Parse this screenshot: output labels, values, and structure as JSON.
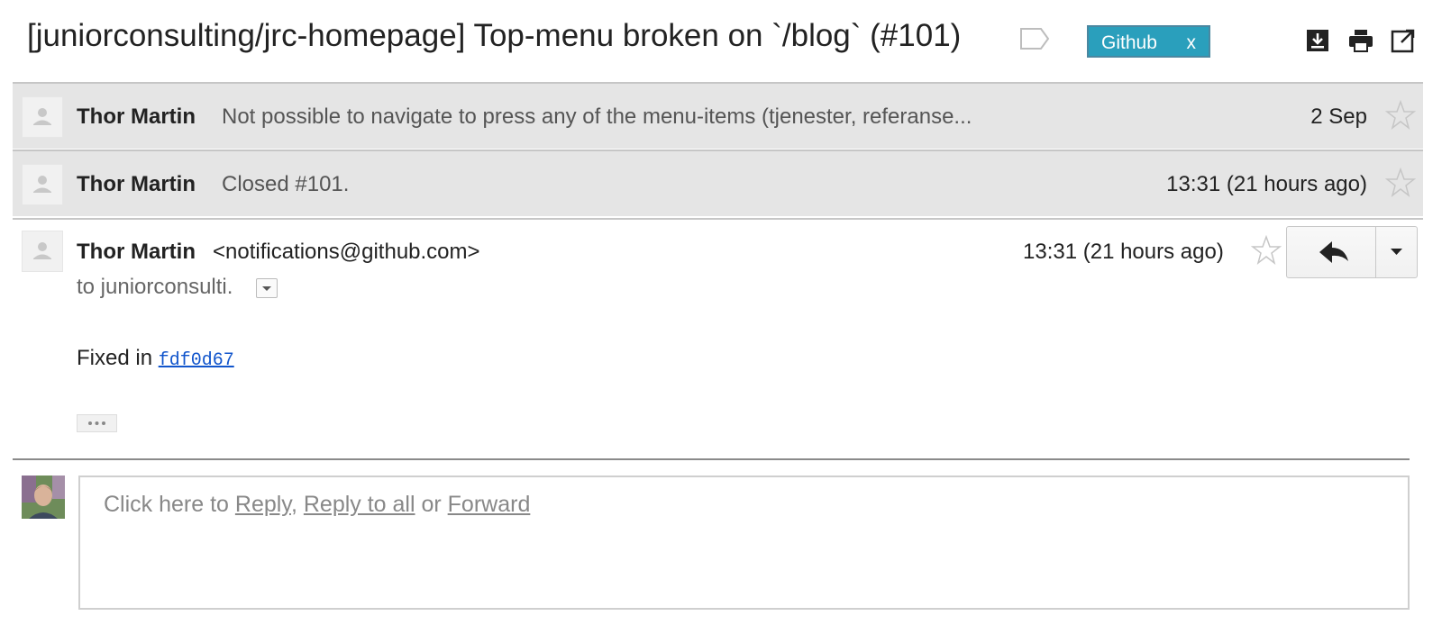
{
  "thread": {
    "subject": "[juniorconsulting/jrc-homepage] Top-menu broken on `/blog` (#101)",
    "label": {
      "name": "Github",
      "remove": "x",
      "color": "#2a9fbc"
    },
    "actions": [
      "download-icon",
      "print-icon",
      "open-in-new-window-icon"
    ]
  },
  "messages": [
    {
      "sender": "Thor Martin",
      "snippet": "Not possible to navigate to press any of the menu-items (tjenester, referanse...",
      "time": "2 Sep"
    },
    {
      "sender": "Thor Martin",
      "snippet": "Closed #101.",
      "time": "13:31 (21 hours ago)"
    }
  ],
  "open_message": {
    "sender": "Thor Martin",
    "email": "<notifications@github.com>",
    "time": "13:31 (21 hours ago)",
    "to": "to juniorconsulti.",
    "body_prefix": "Fixed in ",
    "commit": "fdf0d67"
  },
  "reply_box": {
    "prefix": "Click here to ",
    "reply": "Reply",
    "sep1": ", ",
    "reply_all": "Reply to all",
    "sep2": " or ",
    "forward": "Forward"
  }
}
